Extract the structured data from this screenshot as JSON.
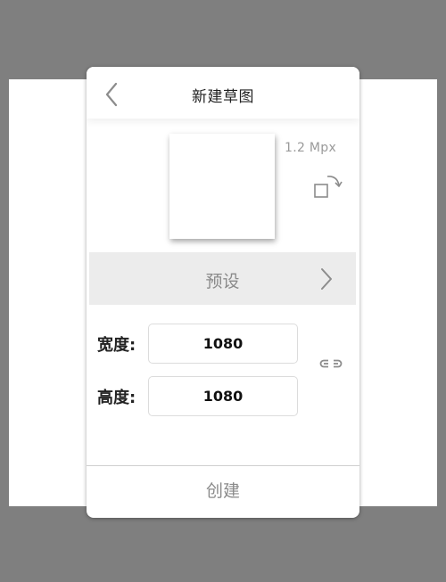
{
  "dialog": {
    "title": "新建草图",
    "back_icon": "chevron-left-icon",
    "resolution": "1.2 Mpx",
    "rotate_icon": "rotate-orientation-icon",
    "preset": {
      "label": "预设",
      "icon": "chevron-right-icon"
    },
    "width": {
      "label": "宽度:",
      "value": "1080"
    },
    "height": {
      "label": "高度:",
      "value": "1080"
    },
    "link_icon": "link-aspect-ratio-icon",
    "create_label": "创建"
  }
}
